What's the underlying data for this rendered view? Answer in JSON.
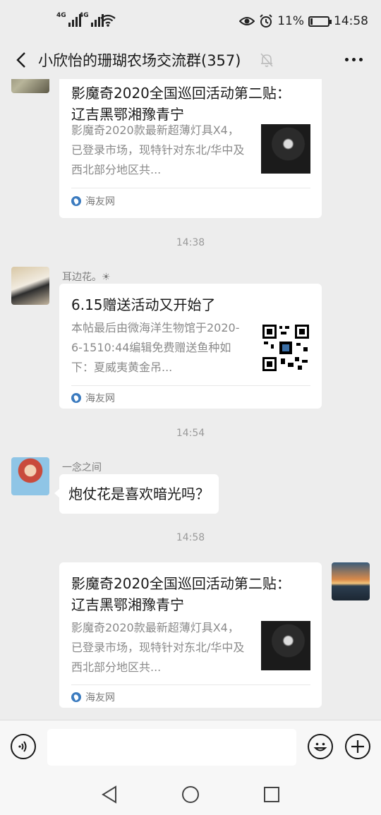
{
  "status_bar": {
    "sim1_label": "4G",
    "sim2_label": "4G",
    "battery_percent_text": "11%",
    "battery_level": 0.11,
    "time": "14:58",
    "icons": [
      "eye-comfort-icon",
      "alarm-icon",
      "battery-icon",
      "wifi-icon"
    ]
  },
  "nav": {
    "title": "小欣怡的珊瑚农场交流群(357)",
    "icons": [
      "back-arrow-icon",
      "mute-bell-icon",
      "more-dots-icon"
    ]
  },
  "messages": {
    "card1": {
      "title": "影魔奇2020全国巡回活动第二贴： 辽吉黑鄂湘豫青宁",
      "desc": "影魔奇2020款最新超薄灯具X4，已登录市场，现特针对东北/华中及西北部分地区共...",
      "source": "海友网"
    },
    "time1": "14:38",
    "msg2": {
      "sender": "耳边花。☀",
      "card": {
        "title": "6.15赠送活动又开始了",
        "desc": "本帖最后由微海洋生物馆于2020-6-1510:44编辑免费赠送鱼种如下：夏威夷黄金吊...",
        "source": "海友网"
      }
    },
    "time2": "14:54",
    "msg3": {
      "sender": "一念之间",
      "text": "炮仗花是喜欢暗光吗？"
    },
    "time3": "14:58",
    "card4": {
      "title": "影魔奇2020全国巡回活动第二贴： 辽吉黑鄂湘豫青宁",
      "desc": "影魔奇2020款最新超薄灯具X4，已登录市场，现特针对东北/华中及西北部分地区共...",
      "source": "海友网"
    }
  },
  "input_bar": {
    "placeholder": "",
    "icons": [
      "voice-icon",
      "emoji-icon",
      "plus-icon"
    ]
  },
  "system_nav": {
    "icons": [
      "nav-back-triangle-icon",
      "nav-home-circle-icon",
      "nav-recents-square-icon"
    ]
  },
  "colors": {
    "background": "#ededed",
    "bubble": "#ffffff",
    "time_gray": "#9a9a9a",
    "source_blue": "#3b7bbf"
  }
}
